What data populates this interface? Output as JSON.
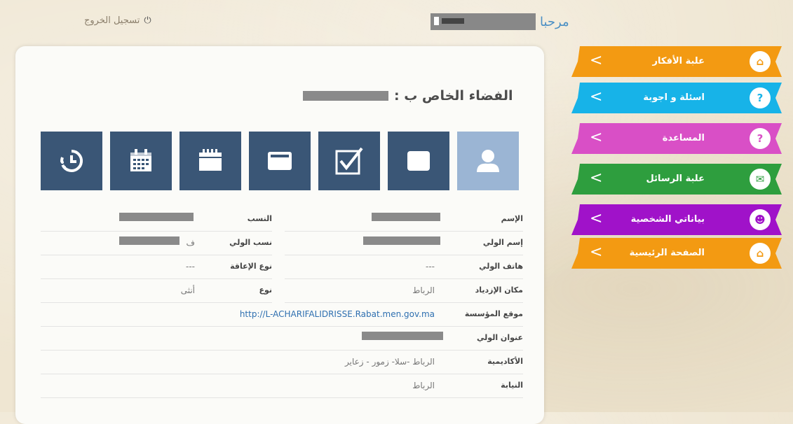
{
  "header": {
    "logout_label": "تسجيل الخروج",
    "welcome_label": "مرحبا"
  },
  "space": {
    "title": "الفضاء الخاص ب :"
  },
  "tiles": [
    {
      "icon": "user-icon",
      "active": true
    },
    {
      "icon": "inbox-icon",
      "active": false
    },
    {
      "icon": "checkbox-icon",
      "active": false
    },
    {
      "icon": "tray-icon",
      "active": false
    },
    {
      "icon": "calendar-icon",
      "active": false
    },
    {
      "icon": "schedule-icon",
      "active": false
    },
    {
      "icon": "history-icon",
      "active": false
    }
  ],
  "info": {
    "right_rows": [
      {
        "label": "الإسم",
        "value": ""
      },
      {
        "label": "إسم الولي",
        "value": ""
      },
      {
        "label": "هاتف الولي",
        "value": "---"
      },
      {
        "label": "مكان الإزدياد",
        "value": "الرباط"
      },
      {
        "label": "موقع المؤسسة",
        "value": "http://L-ACHARIFALIDRISSE.Rabat.men.gov.ma"
      },
      {
        "label": "عنوان الولي",
        "value": ""
      },
      {
        "label": "الأكاديمية",
        "value": "الرباط -سلا- زمور - زعاير"
      },
      {
        "label": "النيابة",
        "value": "الرباط"
      }
    ],
    "left_rows": [
      {
        "label": "النسب",
        "value": ""
      },
      {
        "label": "نسب الولي",
        "value": "ف"
      },
      {
        "label": "نوع الإعاقة",
        "value": "---"
      },
      {
        "label": "نوع",
        "value": "أنثى"
      }
    ]
  },
  "menu": [
    {
      "label": "علبة الأفكار",
      "color": "#f39a12",
      "icon": "home-icon"
    },
    {
      "label": "اسئلة و اجوبة",
      "color": "#17b3e8",
      "icon": "question-icon"
    },
    {
      "label": "المساعدة",
      "color": "#d94fc6",
      "icon": "help-icon"
    },
    {
      "label": "علبة الرسائل",
      "color": "#2e9e3e",
      "icon": "mail-icon"
    },
    {
      "label": "بياناتي الشخصية",
      "color": "#a012c9",
      "icon": "user-icon"
    },
    {
      "label": "الصفحة الرئيسية",
      "color": "#f39a12",
      "icon": "home-icon"
    }
  ]
}
